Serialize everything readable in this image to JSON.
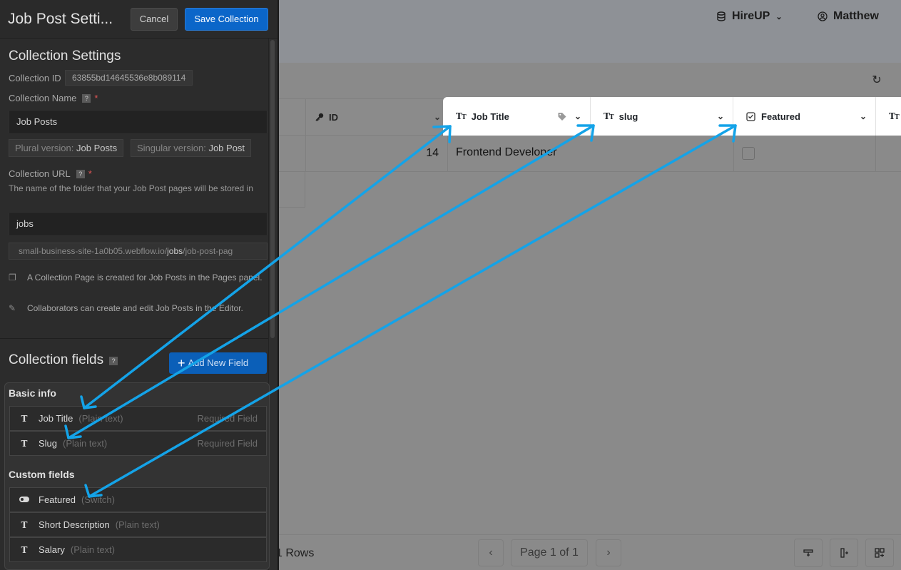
{
  "app": {
    "workspace": "HireUP",
    "user": "Matthew",
    "colors": {
      "accent": "#0b66c9",
      "annotation_arrow": "#14a3e8"
    }
  },
  "grid": {
    "columns": [
      {
        "name": "ID",
        "icon": "key-icon"
      },
      {
        "name": "Job Title",
        "icon": "text-type-icon"
      },
      {
        "name": "slug",
        "icon": "text-type-icon"
      },
      {
        "name": "Featured",
        "icon": "checkbox-icon"
      }
    ],
    "row": {
      "id": "14",
      "job_title": "Frontend Developer",
      "featured": false
    },
    "footer": {
      "rows_label": "1 Rows",
      "page_label": "Page 1 of 1"
    }
  },
  "panel": {
    "title": "Job Post Setti...",
    "cancel_label": "Cancel",
    "save_label": "Save Collection",
    "collection_settings_heading": "Collection Settings",
    "collection_id_label": "Collection ID",
    "collection_id": "63855bd14645536e8b089114",
    "collection_name_label": "Collection Name",
    "collection_name": "Job Posts",
    "plural_label": "Plural version:",
    "plural_value": "Job Posts",
    "singular_label": "Singular version:",
    "singular_value": "Job Post",
    "collection_url_label": "Collection URL",
    "collection_url_help": "The name of the folder that your Job Post pages will be stored in",
    "collection_url": "jobs",
    "url_prefix": "small-business-site-1a0b05.webflow.io/",
    "url_slug": "jobs",
    "url_suffix": "/job-post-pag",
    "info_pages": "A Collection Page is created for Job Posts in the Pages panel.",
    "info_editor": "Collaborators can create and edit Job Posts in the Editor.",
    "fields_heading": "Collection fields",
    "add_field_label": "Add New Field",
    "basic_info_heading": "Basic info",
    "custom_fields_heading": "Custom fields",
    "basic_fields": [
      {
        "name": "Job Title",
        "type": "(Plain text)",
        "note": "Required Field"
      },
      {
        "name": "Slug",
        "type": "(Plain text)",
        "note": "Required Field"
      }
    ],
    "custom_fields": [
      {
        "name": "Featured",
        "type": "(Switch)"
      },
      {
        "name": "Short Description",
        "type": "(Plain text)"
      },
      {
        "name": "Salary",
        "type": "(Plain text)"
      }
    ]
  }
}
